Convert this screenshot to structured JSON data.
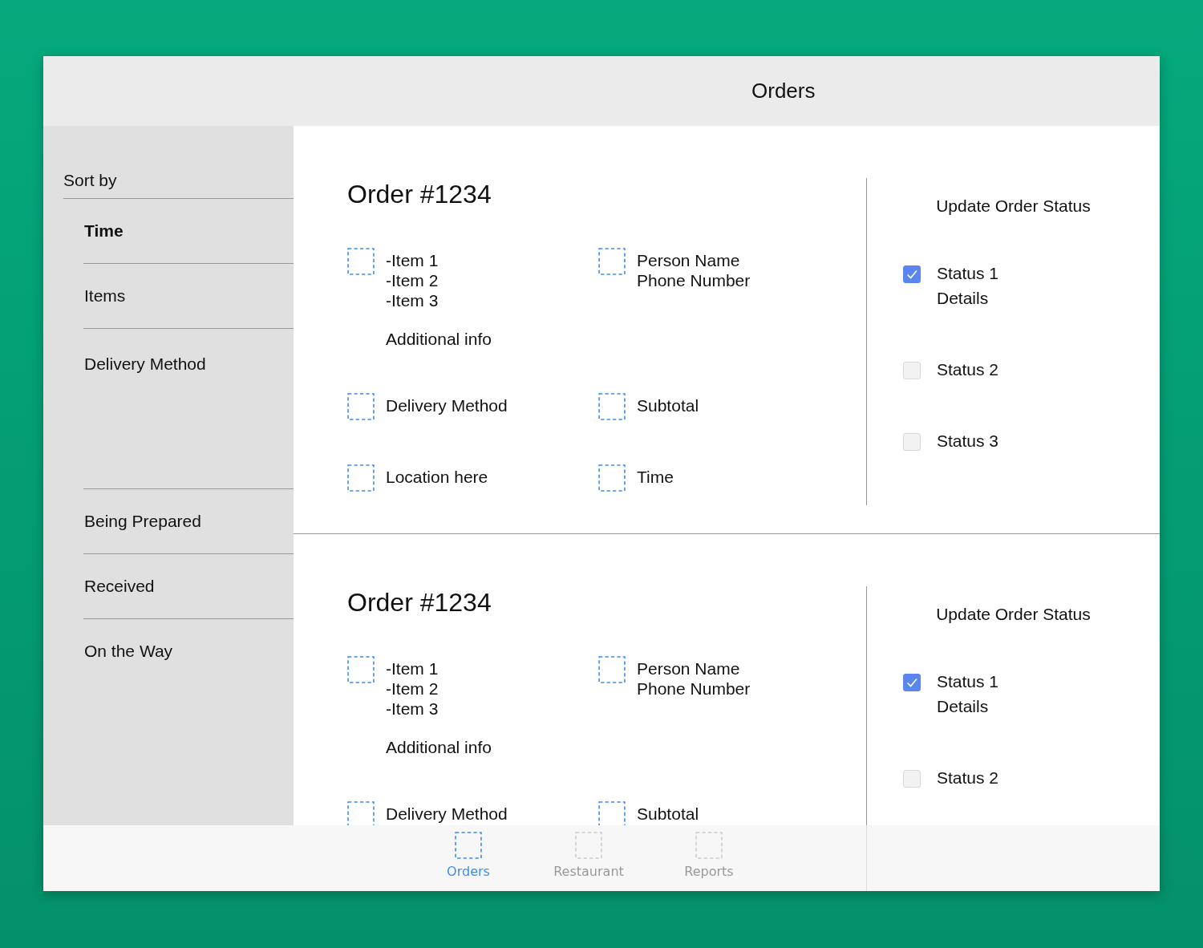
{
  "window": {
    "title": "Orders"
  },
  "sidebar": {
    "heading": "Sort by",
    "sort_options": [
      {
        "label": "Time",
        "selected": true
      },
      {
        "label": "Items",
        "selected": false
      },
      {
        "label": "Delivery Method",
        "selected": false
      }
    ],
    "status_filters": [
      {
        "label": "Being Prepared",
        "selected": false
      },
      {
        "label": "Received",
        "selected": false
      },
      {
        "label": "On the Way",
        "selected": false
      }
    ]
  },
  "orders": [
    {
      "title": "Order #1234",
      "fields": [
        {
          "lines": [
            "-Item 1",
            "-Item 2",
            "-Item 3"
          ],
          "note": "Additional info"
        },
        {
          "lines": [
            "Person Name",
            "Phone Number"
          ]
        },
        {
          "lines": [
            "Delivery Method"
          ]
        },
        {
          "lines": [
            "Subtotal"
          ]
        },
        {
          "lines": [
            "Location here"
          ]
        },
        {
          "lines": [
            "Time"
          ]
        }
      ],
      "status_heading": "Update Order Status",
      "statuses": [
        {
          "label": "Status 1",
          "details": "Details",
          "checked": true
        },
        {
          "label": "Status 2",
          "checked": false
        },
        {
          "label": "Status 3",
          "checked": false
        }
      ]
    },
    {
      "title": "Order #1234",
      "fields": [
        {
          "lines": [
            "-Item 1",
            "-Item 2",
            "-Item 3"
          ],
          "note": "Additional info"
        },
        {
          "lines": [
            "Person Name",
            "Phone Number"
          ]
        },
        {
          "lines": [
            "Delivery Method"
          ]
        },
        {
          "lines": [
            "Subtotal"
          ]
        }
      ],
      "status_heading": "Update Order Status",
      "statuses": [
        {
          "label": "Status 1",
          "details": "Details",
          "checked": true
        },
        {
          "label": "Status 2",
          "checked": false
        }
      ]
    }
  ],
  "tab_bar": [
    {
      "label": "Orders",
      "selected": true
    },
    {
      "label": "Restaurant",
      "selected": false
    },
    {
      "label": "Reports",
      "selected": false
    }
  ]
}
